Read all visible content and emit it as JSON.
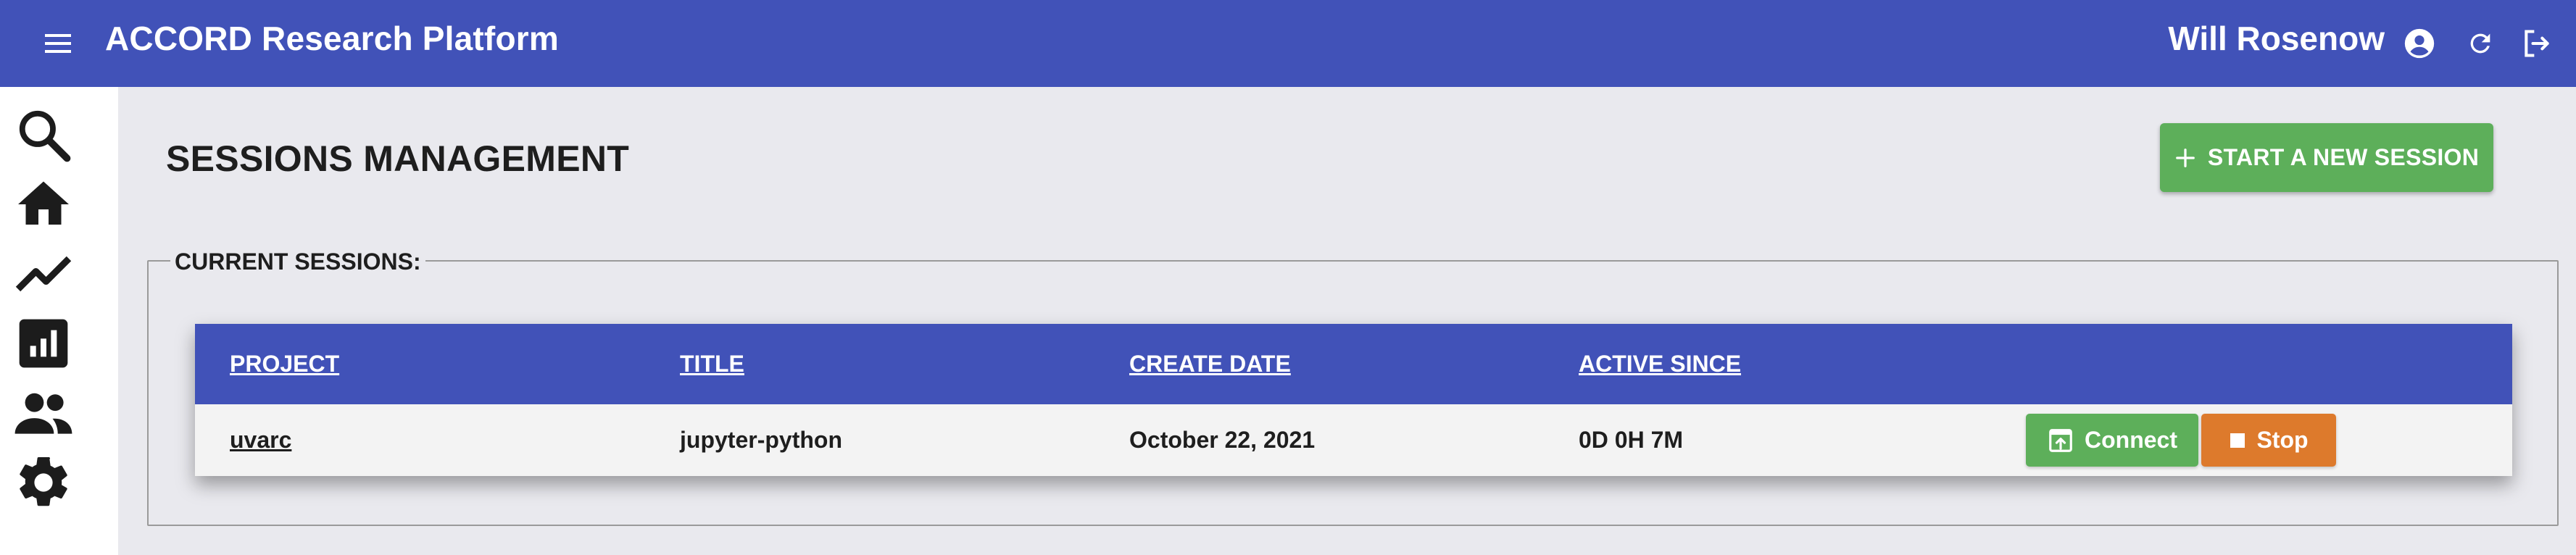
{
  "app": {
    "title": "ACCORD Research Platform",
    "user_name": "Will Rosenow",
    "brand_color": "#4152b8"
  },
  "appbar_icons": {
    "menu": "menu-icon",
    "account": "account-circle-icon",
    "refresh": "refresh-icon",
    "logout": "logout-icon"
  },
  "sidebar": {
    "items": [
      {
        "icon": "search-icon",
        "label": "Search"
      },
      {
        "icon": "home-icon",
        "label": "Home"
      },
      {
        "icon": "trending-icon",
        "label": "Trends"
      },
      {
        "icon": "analytics-icon",
        "label": "Analytics"
      },
      {
        "icon": "people-icon",
        "label": "People"
      },
      {
        "icon": "settings-icon",
        "label": "Settings"
      }
    ]
  },
  "page": {
    "title": "SESSIONS MANAGEMENT",
    "new_session_label": "START A NEW SESSION",
    "new_session_color": "#5daf5a"
  },
  "sessions": {
    "legend": "CURRENT SESSIONS:",
    "columns": [
      "PROJECT",
      "TITLE",
      "CREATE DATE",
      "ACTIVE SINCE"
    ],
    "rows": [
      {
        "project": "uvarc",
        "title": "jupyter-python",
        "create_date": "October 22, 2021",
        "active_since": "0D 0H 7M",
        "connect_label": "Connect",
        "stop_label": "Stop"
      }
    ],
    "connect_color": "#5daf5a",
    "stop_color": "#dd7a2c"
  }
}
